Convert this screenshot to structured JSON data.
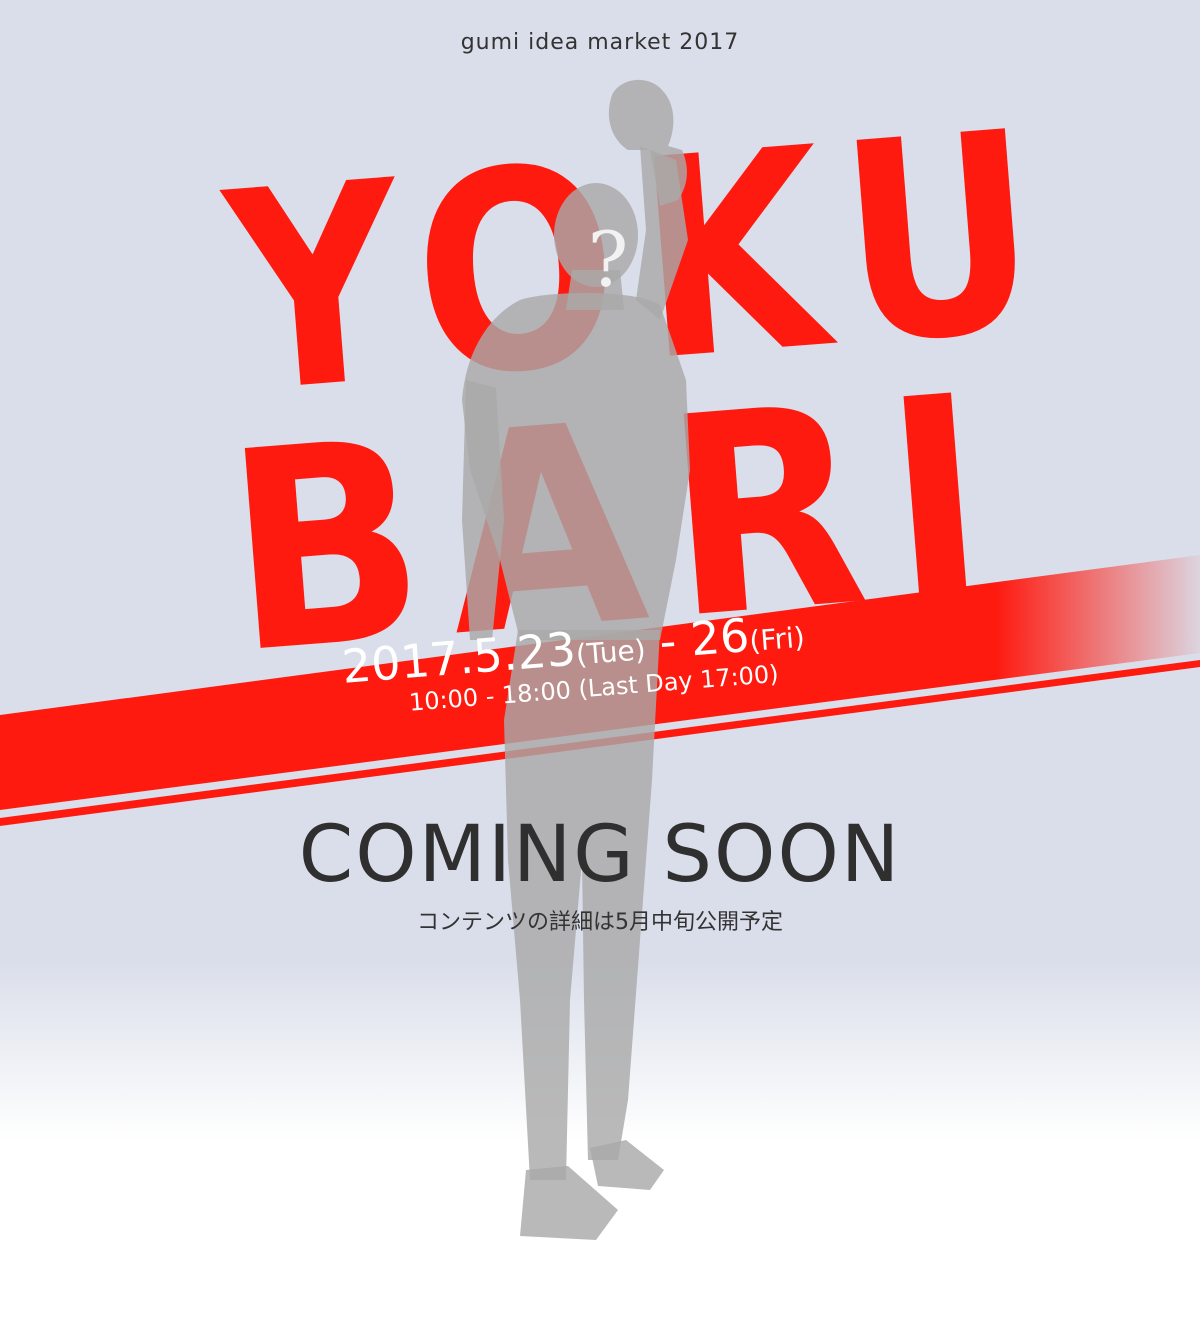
{
  "event_name": "gumi idea market 2017",
  "title": {
    "line1": "YOKU",
    "line2": "BARI"
  },
  "silhouette": {
    "question_mark": "?"
  },
  "dates": {
    "start": "2017.5.23",
    "start_day": "(Tue)",
    "separator": " - ",
    "end": "26",
    "end_day": "(Fri)",
    "hours": "10:00 - 18:00 (Last Day 17:00)"
  },
  "coming_soon": "COMING SOON",
  "coming_soon_note": "コンテンツの詳細は5月中旬公開予定",
  "colors": {
    "accent_red": "#ff1a10",
    "background_top": "#dadeea",
    "silhouette": "#aaaaaa"
  }
}
